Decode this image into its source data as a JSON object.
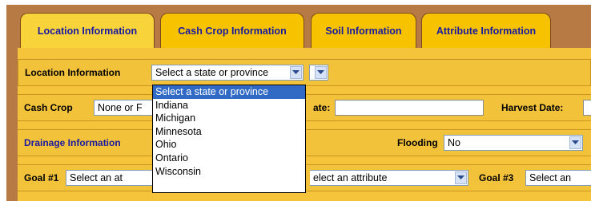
{
  "tabs": [
    {
      "label": "Location Information"
    },
    {
      "label": "Cash Crop Information"
    },
    {
      "label": "Soil Information"
    },
    {
      "label": "Attribute Information"
    }
  ],
  "location": {
    "label": "Location Information",
    "state_select_value": "Select a state or province",
    "dropdown_options": [
      "Select a state or province",
      "Indiana",
      "Michigan",
      "Minnesota",
      "Ohio",
      "Ontario",
      "Wisconsin"
    ]
  },
  "cash_crop": {
    "label": "Cash Crop",
    "value": "None or F",
    "date_label_partial": "ate:",
    "harvest_label": "Harvest Date:"
  },
  "drainage": {
    "label": "Drainage Information",
    "flooding_label": "Flooding",
    "flooding_value": "No"
  },
  "goals": {
    "goal1_label": "Goal #1",
    "goal1_value": "Select an at",
    "goal2_value": "elect an attribute",
    "goal3_label": "Goal #3",
    "goal3_value": "Select an"
  },
  "colors": {
    "tab_bg": "#f7c300",
    "panel_bg": "#f6c43a",
    "frame_bg": "#b77a45",
    "link_blue": "#1a1aa0",
    "selection_blue": "#316ac5"
  }
}
